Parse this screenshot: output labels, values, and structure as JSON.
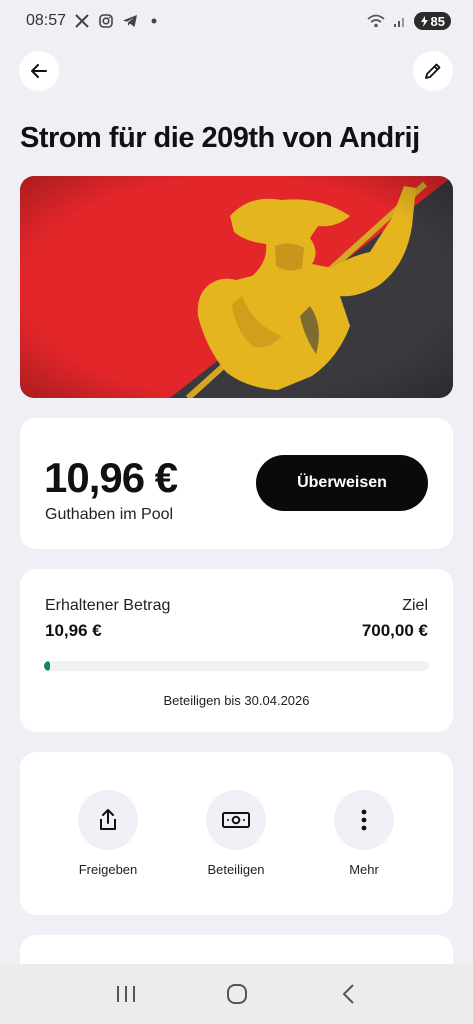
{
  "status": {
    "time": "08:57",
    "battery": "85",
    "icons": [
      "x-icon",
      "instagram-icon",
      "telegram-icon",
      "dot-icon",
      "wifi-icon",
      "signal-icon",
      "battery-icon"
    ]
  },
  "header": {
    "back_icon": "arrow-left-icon",
    "edit_icon": "pencil-icon"
  },
  "title": "Strom für die 209th von Andrij",
  "banner": {
    "colors": {
      "red": "#e3262a",
      "dark": "#3a3a3e",
      "gold": "#e7b827"
    }
  },
  "balance": {
    "amount": "10,96 €",
    "label": "Guthaben im Pool",
    "button": "Überweisen"
  },
  "progress": {
    "received_label": "Erhaltener Betrag",
    "received_value": "10,96 €",
    "goal_label": "Ziel",
    "goal_value": "700,00 €",
    "fraction": 0.0157,
    "deadline": "Beteiligen bis 30.04.2026"
  },
  "actions": [
    {
      "label": "Freigeben",
      "icon": "share-icon"
    },
    {
      "label": "Beteiligen",
      "icon": "money-icon"
    },
    {
      "label": "Mehr",
      "icon": "more-vertical-icon"
    }
  ],
  "colors": {
    "accent": "#0e8a5c",
    "background": "#eef0f6",
    "button": "#0a0a0a"
  }
}
